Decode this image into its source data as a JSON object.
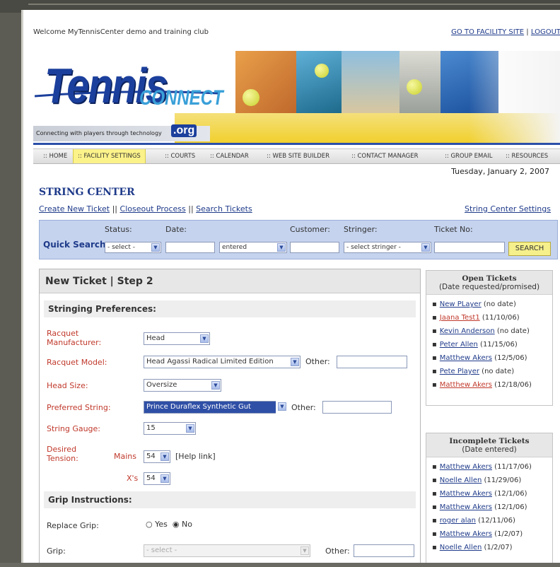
{
  "header": {
    "welcome": "Welcome MyTennisCenter demo and training club",
    "facility_link": "GO TO FACILITY SITE",
    "separator": "|",
    "logout_link": "LOGOUT"
  },
  "logo": {
    "tennis": "Tennis",
    "connect": "CONNECT",
    "org": ".org",
    "tagline": "Connecting with players through technology"
  },
  "nav": {
    "items": [
      "HOME",
      "FACILITY SETTINGS",
      "COURTS",
      "CALENDAR",
      "WEB SITE BUILDER",
      "CONTACT MANAGER",
      "GROUP EMAIL",
      "RESOURCES"
    ]
  },
  "date": "Tuesday, January 2, 2007",
  "string_center": {
    "title": "STRING CENTER",
    "links": [
      "Create New Ticket",
      "Closeout Process",
      "Search Tickets"
    ],
    "link_sep": "||",
    "settings_link": "String Center Settings"
  },
  "quick_search": {
    "title": "Quick Search",
    "status_label": "Status:",
    "status_value": "- select -",
    "date_label": "Date:",
    "date_mode": "entered",
    "customer_label": "Customer:",
    "stringer_label": "Stringer:",
    "stringer_value": "- select stringer -",
    "ticket_label": "Ticket No:",
    "search_button": "SEARCH"
  },
  "form": {
    "heading": "New Ticket | Step 2",
    "stringing_section": "Stringing Preferences:",
    "racquet_manufacturer_label": "Racquet Manufacturer:",
    "racquet_manufacturer_value": "Head",
    "racquet_model_label": "Racquet Model:",
    "racquet_model_value": "Head Agassi Radical Limited Edition",
    "other_label": "Other:",
    "head_size_label": "Head Size:",
    "head_size_value": "Oversize",
    "preferred_string_label": "Preferred String:",
    "preferred_string_value": "Prince Duraflex Synthetic Gut",
    "string_gauge_label": "String Gauge:",
    "string_gauge_value": "15",
    "desired_tension_label": "Desired Tension:",
    "mains_label": "Mains",
    "mains_value": "54",
    "help_link": "[Help link]",
    "crosses_label": "X's",
    "crosses_value": "54",
    "grip_section": "Grip Instructions:",
    "replace_grip_label": "Replace Grip:",
    "yes_label": "Yes",
    "no_label": "No",
    "grip_label": "Grip:",
    "grip_value": "- select -"
  },
  "open_tickets": {
    "title": "Open Tickets",
    "subtitle": "(Date requested/promised)",
    "items": [
      {
        "name": "New PLayer",
        "date": "(no date)",
        "red": false
      },
      {
        "name": "Jaana Test1",
        "date": "(11/10/06)",
        "red": true
      },
      {
        "name": "Kevin Anderson",
        "date": "(no date)",
        "red": false
      },
      {
        "name": "Peter Allen",
        "date": "(11/15/06)",
        "red": false
      },
      {
        "name": "Matthew Akers",
        "date": "(12/5/06)",
        "red": false
      },
      {
        "name": "Pete Player",
        "date": "(no date)",
        "red": false
      },
      {
        "name": "Matthew Akers",
        "date": "(12/18/06)",
        "red": true
      }
    ]
  },
  "incomplete_tickets": {
    "title": "Incomplete Tickets",
    "subtitle": "(Date entered)",
    "items": [
      {
        "name": "Matthew Akers",
        "date": "(11/17/06)"
      },
      {
        "name": "Noelle Allen",
        "date": "(11/29/06)"
      },
      {
        "name": "Matthew Akers",
        "date": "(12/1/06)"
      },
      {
        "name": "Matthew Akers",
        "date": "(12/1/06)"
      },
      {
        "name": "roger alan",
        "date": "(12/11/06)"
      },
      {
        "name": "Matthew Akers",
        "date": "(1/2/07)"
      },
      {
        "name": "Noelle Allen",
        "date": "(1/2/07)"
      }
    ]
  },
  "colors": {
    "brand_navy": "#1b3f9c",
    "link": "#1f3b8a",
    "required_label": "#c0392b",
    "highlight_yellow": "#fbf28a",
    "quick_search_bg": "#c5d3ee"
  }
}
